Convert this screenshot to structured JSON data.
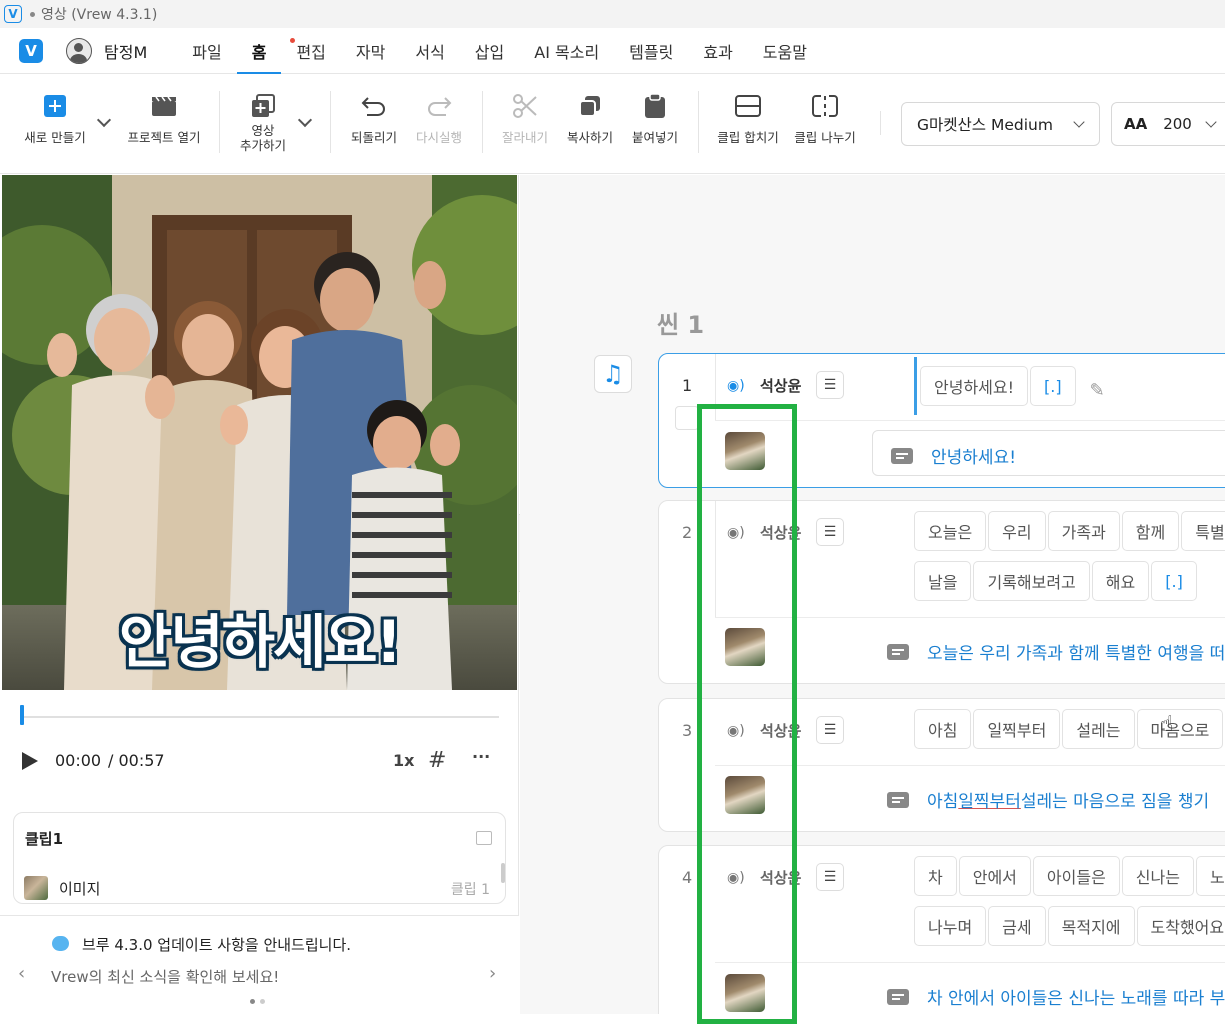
{
  "titlebar": {
    "title": "영상 (Vrew 4.3.1)"
  },
  "menubar": {
    "team": "탐정M",
    "items": [
      "파일",
      "홈",
      "편집",
      "자막",
      "서식",
      "삽입",
      "AI 목소리",
      "템플릿",
      "효과",
      "도움말"
    ],
    "active": "홈"
  },
  "toolbar": {
    "new": "새로 만들기",
    "open": "프로젝트 열기",
    "add_video_1": "영상",
    "add_video_2": "추가하기",
    "undo": "되돌리기",
    "redo": "다시실행",
    "cut": "잘라내기",
    "copy": "복사하기",
    "paste": "붙여넣기",
    "merge": "클립 합치기",
    "split": "클립 나누기",
    "font": "G마켓산스 Medium",
    "font_size": "200"
  },
  "preview": {
    "caption": "안녕하세요!",
    "time_current": "00:00",
    "time_total": "/ 00:57",
    "speed": "1x",
    "progress": 0.0
  },
  "clip_card": {
    "title": "클립1",
    "type": "이미지",
    "num": "클립 1"
  },
  "news": {
    "title": "브루 4.3.0 업데이트 사항을 안내드립니다.",
    "subtitle": "Vrew의 최신 소식을 확인해 보세요!"
  },
  "editor": {
    "scene": "씬 1",
    "clips": [
      {
        "num": "1",
        "speaker": "석상윤",
        "rows": [
          [
            "안녕하세요!",
            "[.]"
          ]
        ],
        "subtitle": "안녕하세요!"
      },
      {
        "num": "2",
        "speaker": "석상윤",
        "rows": [
          [
            "오늘은",
            "우리",
            "가족과",
            "함께",
            "특별"
          ],
          [
            "날을",
            "기록해보려고",
            "해요",
            "[.]"
          ]
        ],
        "subtitle": "오늘은 우리 가족과 함께 특별한 여행을 떠"
      },
      {
        "num": "3",
        "speaker": "석상윤",
        "rows": [
          [
            "아침",
            "일찍부터",
            "설레는",
            "마음으로"
          ]
        ],
        "subtitle_a": "아침 ",
        "subtitle_u": "일찍부터",
        "subtitle_b": " 설레는 마음으로 짐을 챙기"
      },
      {
        "num": "4",
        "speaker": "석상윤",
        "rows": [
          [
            "차",
            "안에서",
            "아이들은",
            "신나는",
            "노"
          ],
          [
            "나누며",
            "금세",
            "목적지에",
            "도착했어요"
          ]
        ],
        "subtitle": "차 안에서 아이들은 신나는 노래를 따라 부"
      }
    ]
  }
}
